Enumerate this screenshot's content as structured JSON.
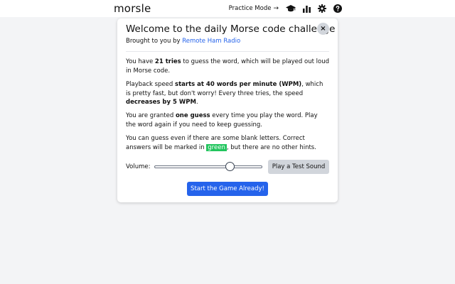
{
  "header": {
    "logo": "morsle",
    "practice_label": "Practice Mode",
    "practice_arrow": "→",
    "icons": [
      "graduation-cap-icon",
      "bar-chart-icon",
      "gear-icon",
      "help-icon"
    ]
  },
  "modal": {
    "title": "Welcome to the daily Morse code challenge",
    "close_label": "×",
    "subtitle_prefix": "Brought to you by ",
    "subtitle_link": "Remote Ham Radio",
    "p1": {
      "a": "You have ",
      "b": "21 tries",
      "c": " to guess the word, which will be played out loud in Morse code."
    },
    "p2": {
      "a": "Playback speed ",
      "b": "starts at 40 words per minute (WPM)",
      "c": ", which is pretty fast, but don't worry! Every three tries, the speed ",
      "d": "decreases by 5 WPM",
      "e": "."
    },
    "p3": {
      "a": "You are granted ",
      "b": "one guess",
      "c": " every time you play the word. Play the word again if you need to keep guessing."
    },
    "p4": {
      "a": "You can guess even if there are some blank letters. Correct answers will be marked in ",
      "b": "green",
      "c": ", but there are no other hints."
    },
    "volume_label": "Volume:",
    "volume_value": 0.7,
    "test_sound_label": "Play a Test Sound",
    "start_label": "Start the Game Already!"
  },
  "colors": {
    "accent": "#2563eb",
    "correct": "#22c55e",
    "background": "#f3f4f6"
  }
}
